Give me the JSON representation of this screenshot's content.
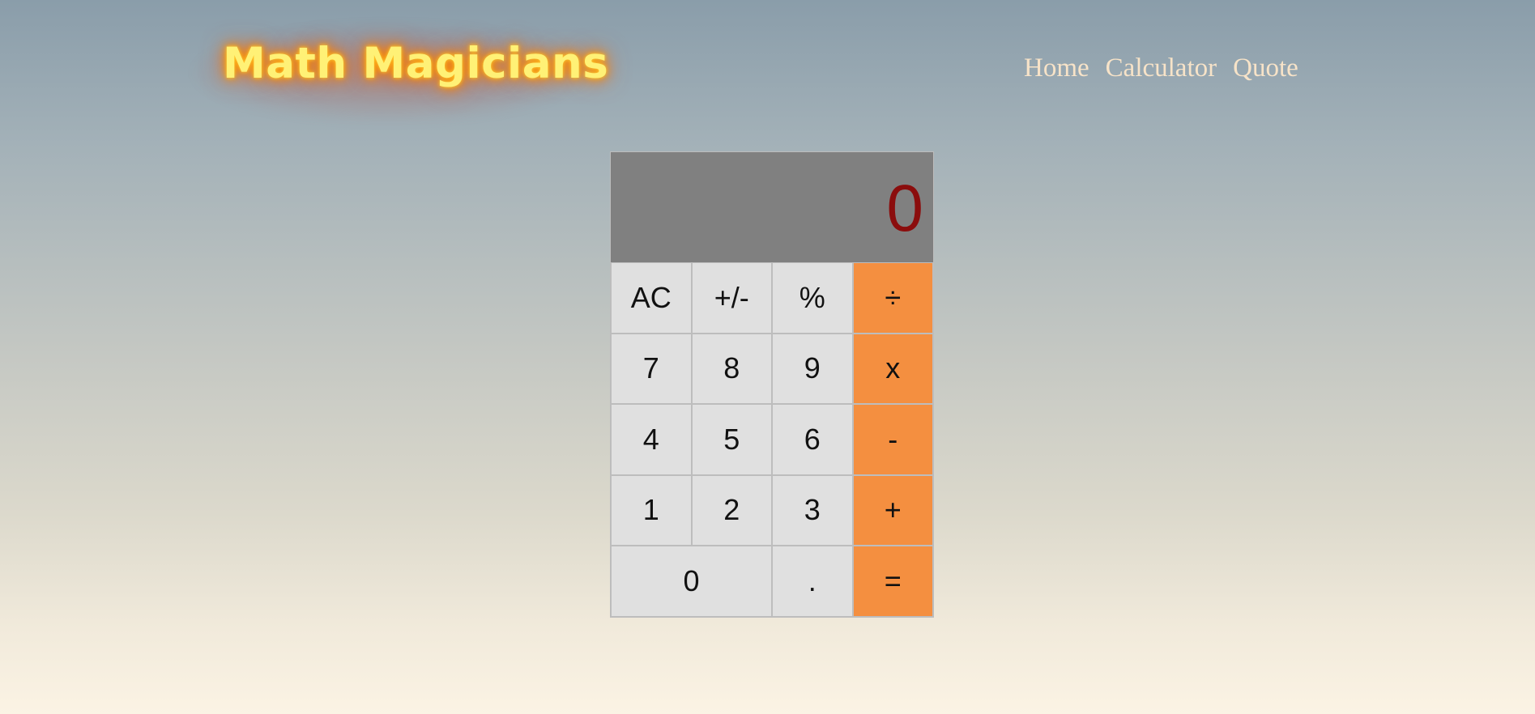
{
  "header": {
    "logo": "Math Magicians",
    "nav": [
      "Home",
      "Calculator",
      "Quote"
    ]
  },
  "calculator": {
    "display": "0",
    "keys": [
      "AC",
      "+/-",
      "%",
      "÷",
      "7",
      "8",
      "9",
      "x",
      "4",
      "5",
      "6",
      "-",
      "1",
      "2",
      "3",
      "+",
      "0",
      ".",
      "="
    ]
  },
  "colors": {
    "operator_key": "#f48f40",
    "number_key": "#e0e0e0",
    "display_background": "#808080",
    "display_text": "#8b0d0d",
    "logo_text": "#fff176",
    "nav_text": "#f7e3c8"
  }
}
